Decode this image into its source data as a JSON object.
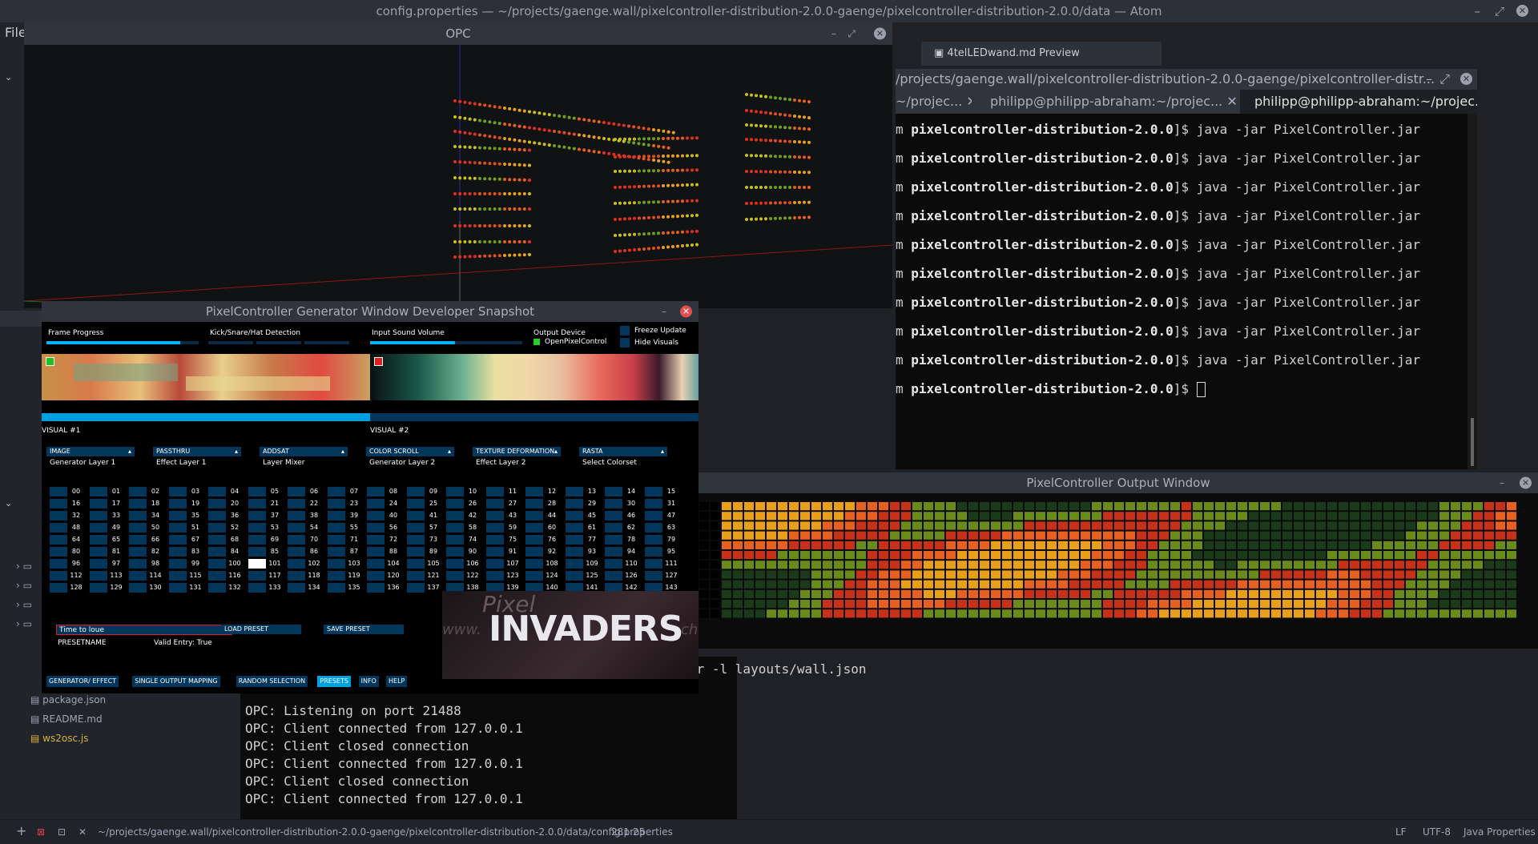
{
  "atom": {
    "title": "config.properties — ~/projects/gaenge.wall/pixelcontroller-distribution-2.0.0-gaenge/pixelcontroller-distribution-2.0.0/data — Atom",
    "menu_file": "File",
    "preview_tab": "4telLEDwand.md Preview",
    "tree_files": [
      "package.json",
      "README.md",
      "ws2osc.js"
    ],
    "status": {
      "path": "~/projects/gaenge.wall/pixelcontroller-distribution-2.0.0-gaenge/pixelcontroller-distribution-2.0.0/data/config.properties",
      "cursor": "281:25",
      "line_ending": "LF",
      "encoding": "UTF-8",
      "grammar": "Java Properties"
    }
  },
  "terminal": {
    "title": "/projects/gaenge.wall/pixelcontroller-distribution-2.0.0-gaenge/pixelcontroller-distr...",
    "tabs": [
      "~/projec...",
      "philipp@philipp-abraham:~/projec...",
      "philipp@philipp-abraham:~/projec..."
    ],
    "prompt_prefix": "m ",
    "prompt_dir": "pixelcontroller-distribution-2.0.0",
    "prompt_sym": "]$ ",
    "command": "java -jar PixelController.jar",
    "repeat_count": 9
  },
  "terminal2": {
    "partial_cmd": "er -l layouts/wall.json",
    "lines": [
      "OPC: Listening on port 21488",
      "OPC: Client connected from 127.0.0.1",
      "OPC: Client closed connection",
      "OPC: Client connected from 127.0.0.1",
      "OPC: Client closed connection",
      "OPC: Client connected from 127.0.0.1"
    ]
  },
  "opc": {
    "title": "OPC"
  },
  "generator": {
    "title": "PixelController Generator Window Developer Snapshot",
    "frame_progress": "Frame Progress",
    "frame_progress_value": 0.88,
    "kick_label": "Kick/Snare/Hat Detection",
    "input_sound": "Input Sound Volume",
    "input_sound_value": 0.56,
    "output_device": "Output Device",
    "output_device_value": "OpenPixelControl",
    "freeze_update": "Freeze Update",
    "hide_visuals": "Hide Visuals",
    "visual1": "VISUAL #1",
    "visual2": "VISUAL #2",
    "dropdowns": [
      {
        "value": "IMAGE",
        "label": "Generator Layer 1"
      },
      {
        "value": "PASSTHRU",
        "label": "Effect Layer 1"
      },
      {
        "value": "ADDSAT",
        "label": "Layer Mixer"
      },
      {
        "value": "COLOR SCROLL",
        "label": "Generator Layer 2"
      },
      {
        "value": "TEXTURE DEFORMATION",
        "label": "Effect Layer 2"
      },
      {
        "value": "RASTA",
        "label": "Select Colorset"
      }
    ],
    "preset_input_value": "Time to loue",
    "presetname": "PRESETNAME",
    "valid_entry": "Valid Entry: True",
    "load_preset": "LOAD PRESET",
    "save_preset": "SAVE PRESET",
    "selected_preset": "101",
    "tabs": [
      "GENERATOR/ EFFECT",
      "SINGLE OUTPUT MAPPING",
      "RANDOM SELECTION",
      "PRESETS",
      "INFO",
      "HELP"
    ],
    "active_tab": "PRESETS",
    "logo_text": "INVADERS",
    "logo_small": "Pixel",
    "logo_url_left": "www.",
    "logo_url_right": "ch"
  },
  "output": {
    "title": "PixelController Output Window"
  },
  "colors": {
    "accent": "#00b4ff",
    "button": "#02365a",
    "active": "#00a0e0"
  }
}
